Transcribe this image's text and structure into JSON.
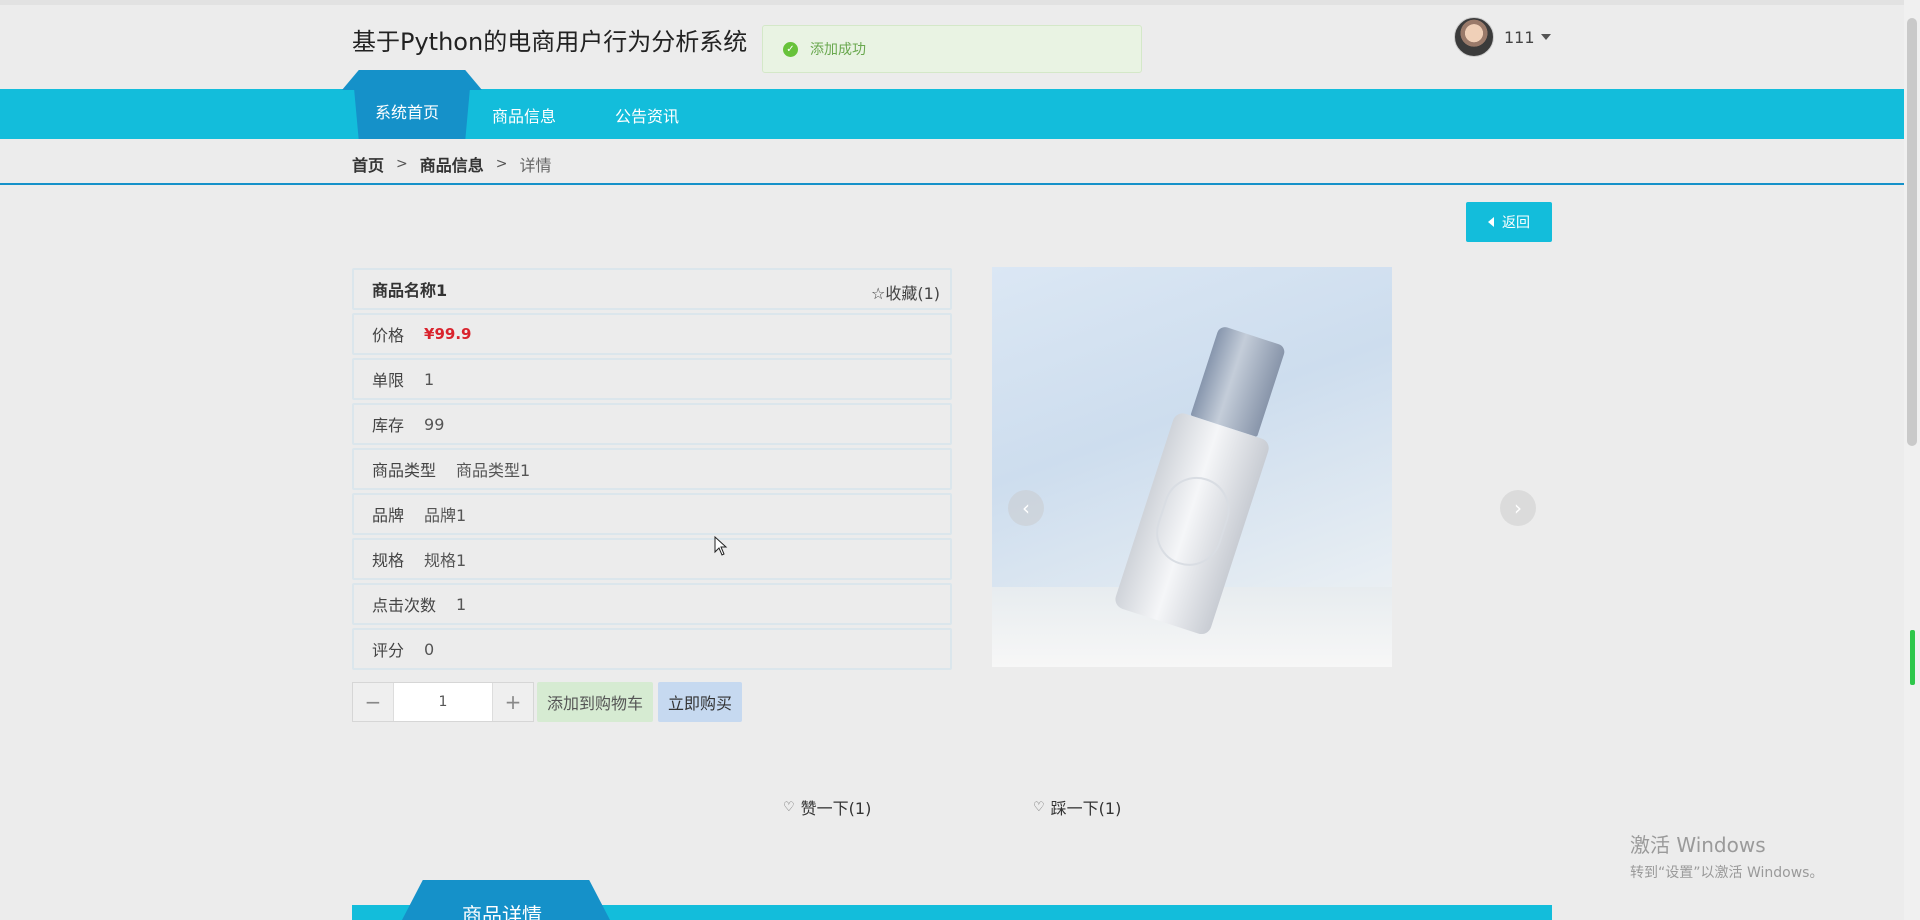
{
  "header": {
    "title": "基于Python的电商用户行为分析系统",
    "user_name": "111"
  },
  "toast": {
    "message": "添加成功"
  },
  "nav": {
    "items": [
      "系统首页",
      "商品信息",
      "公告资讯"
    ]
  },
  "breadcrumb": {
    "home": "首页",
    "section": "商品信息",
    "current": "详情",
    "separator": ">"
  },
  "back_button": {
    "label": "返回"
  },
  "product": {
    "name": "商品名称1",
    "favorite_label": "☆收藏(1)",
    "fields": [
      {
        "label": "价格",
        "value": "¥99.9"
      },
      {
        "label": "单限",
        "value": "1"
      },
      {
        "label": "库存",
        "value": "99"
      },
      {
        "label": "商品类型",
        "value": "商品类型1"
      },
      {
        "label": "品牌",
        "value": "品牌1"
      },
      {
        "label": "规格",
        "value": "规格1"
      },
      {
        "label": "点击次数",
        "value": "1"
      },
      {
        "label": "评分",
        "value": "0"
      }
    ]
  },
  "quantity": {
    "minus": "−",
    "value": "1",
    "plus": "+"
  },
  "actions": {
    "add_to_cart": "添加到购物车",
    "buy_now": "立即购买"
  },
  "votes": {
    "like": "赞一下(1)",
    "dislike": "踩一下(1)"
  },
  "detail_section": {
    "title": "商品详情"
  },
  "watermark": {
    "line1": "激活 Windows",
    "line2": "转到“设置”以激活 Windows。"
  },
  "colors": {
    "nav": "#13bddb",
    "active_tab": "#1591c9",
    "price": "#d9232d"
  }
}
